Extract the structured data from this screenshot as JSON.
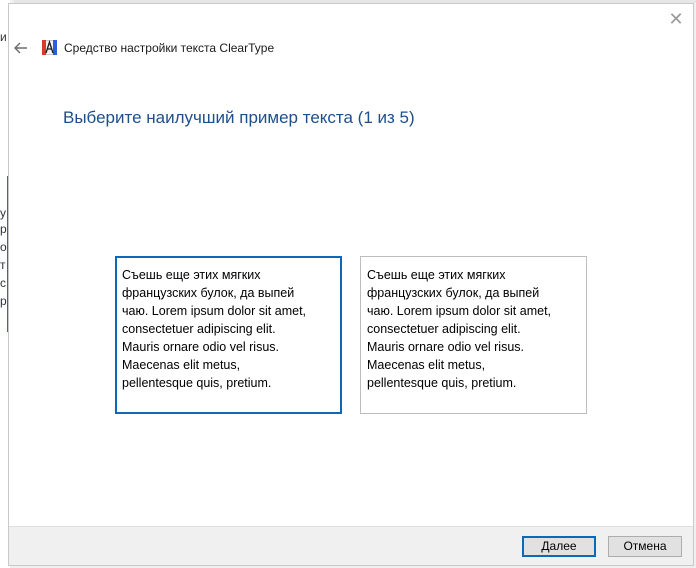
{
  "window": {
    "title": "Средство настройки текста ClearType",
    "close_glyph": "✕",
    "back_glyph": "←"
  },
  "page": {
    "heading": "Выберите наилучший пример текста (1 из 5)"
  },
  "samples": [
    {
      "selected": true,
      "lines": [
        "Съешь еще этих мягких",
        "французских булок, да выпей",
        "чаю. Lorem ipsum dolor sit amet,",
        "consectetuer adipiscing elit.",
        "Mauris ornare odio vel risus.",
        "Maecenas elit metus,",
        "pellentesque quis, pretium."
      ]
    },
    {
      "selected": false,
      "lines": [
        "Съешь еще этих мягких",
        "французских булок, да выпей",
        "чаю. Lorem ipsum dolor sit amet,",
        "consectetuer adipiscing elit.",
        "Mauris ornare odio vel risus.",
        "Maecenas elit metus,",
        "pellentesque quis, pretium."
      ]
    }
  ],
  "footer": {
    "next_label": "Далее",
    "cancel_label": "Отмена"
  },
  "background_window": {
    "glyphs": [
      "и",
      "у",
      "р",
      "о",
      "т",
      "с",
      "р"
    ]
  },
  "colors": {
    "accent": "#0e67b7",
    "heading": "#1e4e8c"
  }
}
